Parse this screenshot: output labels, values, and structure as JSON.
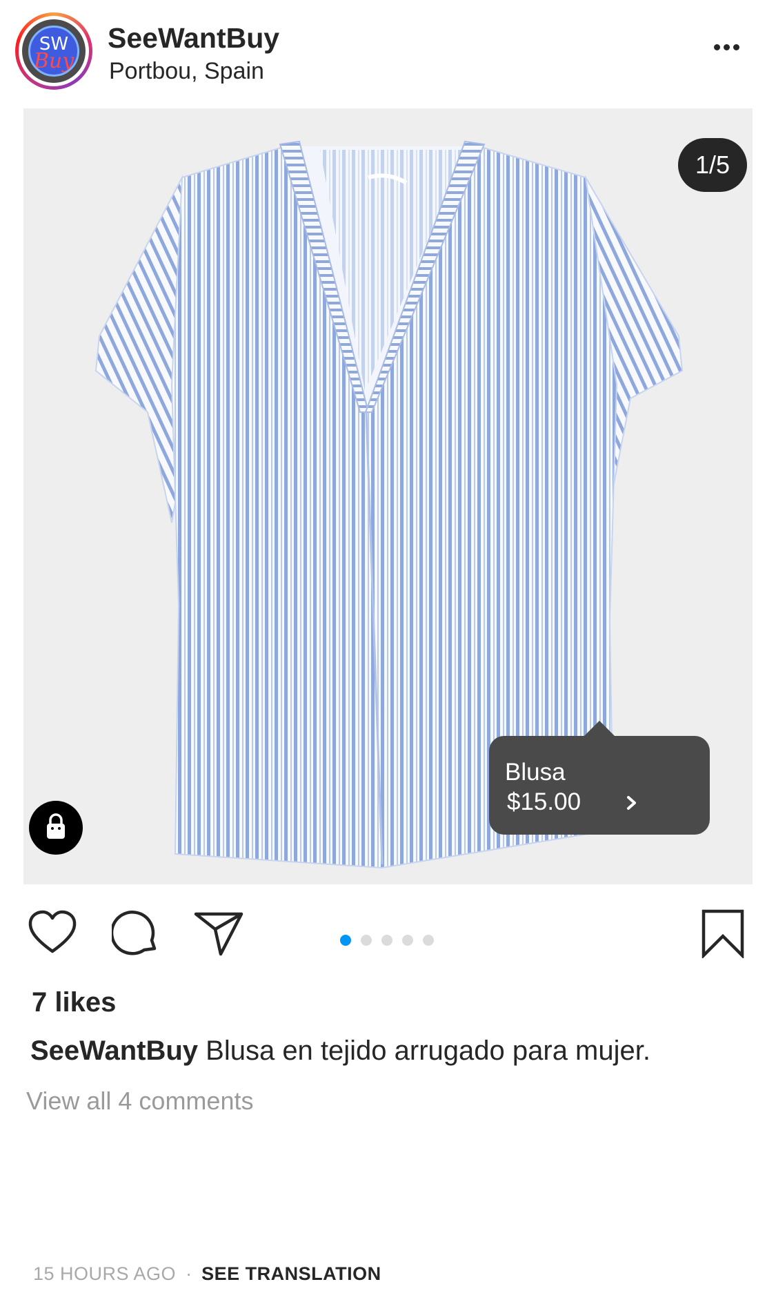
{
  "header": {
    "avatar_text_top": "SW",
    "avatar_text_bottom": "Buy",
    "username": "SeeWantBuy",
    "location": "Portbou, Spain",
    "more_icon": "more-horizontal-icon"
  },
  "media": {
    "counter": "1/5",
    "current_index": 1,
    "total": 5,
    "shopping_icon": "shopping-bag-icon",
    "product_tag": {
      "name": "Blusa",
      "price": "$15.00",
      "icon": "chevron-right-icon"
    }
  },
  "actions": {
    "like_icon": "heart-icon",
    "comment_icon": "comment-icon",
    "share_icon": "send-icon",
    "save_icon": "bookmark-icon",
    "active_dot_color": "#0095f6"
  },
  "post": {
    "likes": "7 likes",
    "caption_user": "SeeWantBuy",
    "caption_text": "Blusa en tejido arrugado para mujer.",
    "view_comments": "View all 4 comments",
    "time": "15 HOURS AGO",
    "separator": "·",
    "see_translation": "SEE TRANSLATION"
  }
}
